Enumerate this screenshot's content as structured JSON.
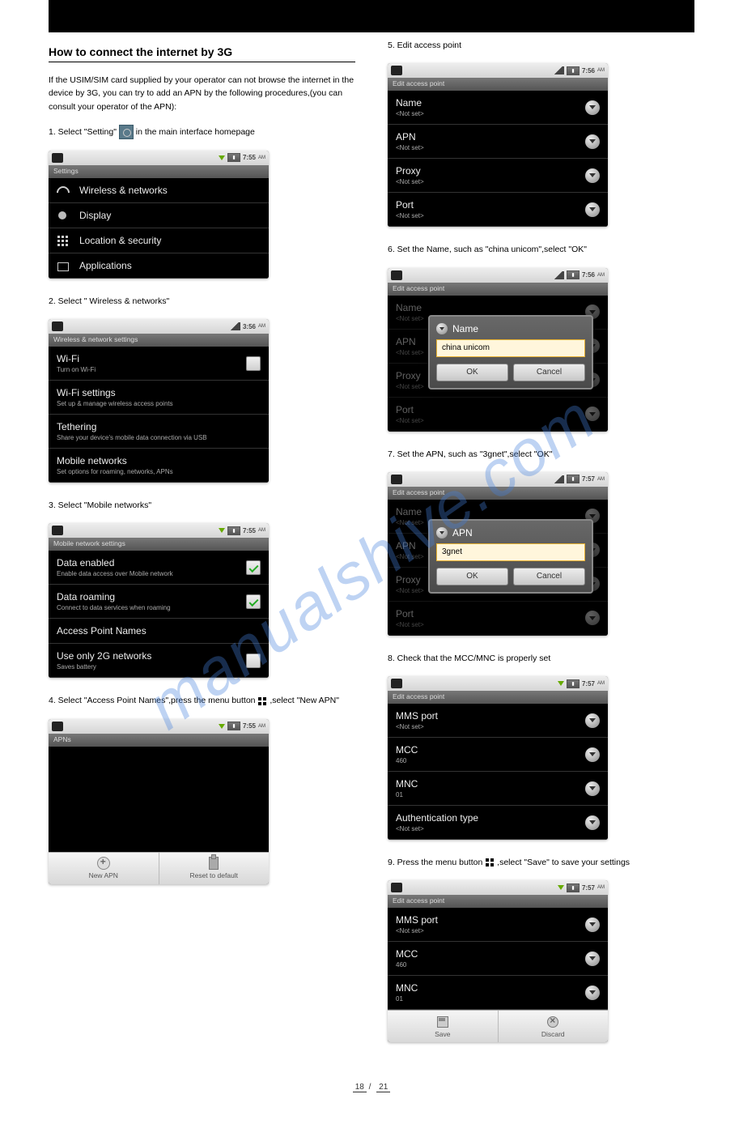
{
  "section_title": "How to connect the internet by 3G",
  "intro1": "If the USIM/SIM card supplied by your operator can not browse the internet in the device by 3G, you can try to add an APN by the following procedures,(you can consult your operator of the APN):",
  "intro2_prefix": "1. Select \"Setting\"",
  "intro2_suffix": " in the main interface homepage",
  "step2": "2. Select \" Wireless & networks\"",
  "step3": "3. Select \"Mobile networks\"",
  "step4_prefix": "4. Select \"Access Point Names\",press the menu button",
  "step4_suffix": ",select \"New APN\"",
  "step5": "5. Edit access point",
  "step6": "6. Set the Name, such as \"china unicom\",select \"OK\"",
  "step7": "7. Set the APN, such as \"3gnet\",select \"OK\"",
  "step8": "8. Check that the MCC/MNC is properly set",
  "step9_prefix": "9. Press the menu button",
  "step9_suffix": ",select \"Save\" to save your settings",
  "page_current": "18",
  "page_total": "21",
  "watermark": "manualshive.com",
  "shots": {
    "settings": {
      "header": "Settings",
      "time": "7:55",
      "am": "AM",
      "rows": [
        {
          "title": "Wireless & networks"
        },
        {
          "title": "Display"
        },
        {
          "title": "Location & security"
        },
        {
          "title": "Applications"
        }
      ]
    },
    "wireless": {
      "header": "Wireless & network settings",
      "time": "3:56",
      "am": "AM",
      "rows": [
        {
          "title": "Wi-Fi",
          "sub": "Turn on Wi-Fi"
        },
        {
          "title": "Wi-Fi settings",
          "sub": "Set up & manage wireless access points"
        },
        {
          "title": "Tethering",
          "sub": "Share your device's mobile data connection via USB"
        },
        {
          "title": "Mobile networks",
          "sub": "Set options for roaming, networks, APNs"
        }
      ]
    },
    "mobile": {
      "header": "Mobile network settings",
      "time": "7:55",
      "am": "AM",
      "rows": [
        {
          "title": "Data enabled",
          "sub": "Enable data access over Mobile network"
        },
        {
          "title": "Data roaming",
          "sub": "Connect to data services when roaming"
        },
        {
          "title": "Access Point Names"
        },
        {
          "title": "Use only 2G networks",
          "sub": "Saves battery"
        }
      ]
    },
    "apns": {
      "header": "APNs",
      "time": "7:55",
      "am": "AM",
      "btn1": "New APN",
      "btn2": "Reset to default"
    },
    "edit1": {
      "header": "Edit access point",
      "time": "7:56",
      "am": "AM",
      "notset": "<Not set>",
      "rows": [
        "Name",
        "APN",
        "Proxy",
        "Port"
      ]
    },
    "dlg_name": {
      "header": "Edit access point",
      "time": "7:56",
      "am": "AM",
      "faded": [
        "Name",
        "APN",
        "Proxy",
        "Port"
      ],
      "notset": "<Not set>",
      "dtitle": "Name",
      "value": "china unicom",
      "ok": "OK",
      "cancel": "Cancel"
    },
    "dlg_apn": {
      "header": "Edit access point",
      "time": "7:57",
      "am": "AM",
      "faded": [
        "Name",
        "APN",
        "Proxy",
        "Port"
      ],
      "notset": "<Not set>",
      "dtitle": "APN",
      "value": "3gnet",
      "ok": "OK",
      "cancel": "Cancel"
    },
    "edit2": {
      "header": "Edit access point",
      "time": "7:57",
      "am": "AM",
      "rows": [
        {
          "title": "MMS port",
          "sub": "<Not set>"
        },
        {
          "title": "MCC",
          "sub": "460"
        },
        {
          "title": "MNC",
          "sub": "01"
        },
        {
          "title": "Authentication type",
          "sub": "<Not set>"
        }
      ]
    },
    "edit3": {
      "header": "Edit access point",
      "time": "7:57",
      "am": "AM",
      "rows": [
        {
          "title": "MMS port",
          "sub": "<Not set>"
        },
        {
          "title": "MCC",
          "sub": "460"
        },
        {
          "title": "MNC",
          "sub": "01"
        }
      ],
      "btn1": "Save",
      "btn2": "Discard"
    }
  }
}
